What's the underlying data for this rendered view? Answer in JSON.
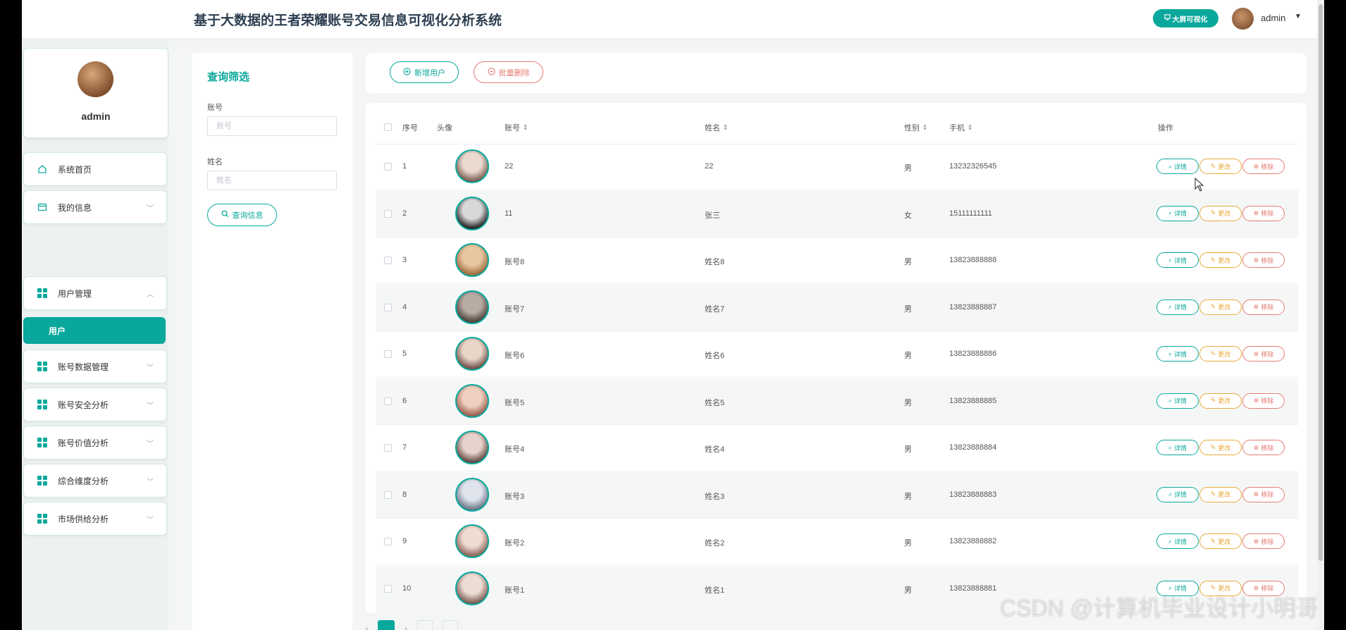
{
  "header": {
    "title": "基于大数据的王者荣耀账号交易信息可视化分析系统",
    "bigscreen_label": "大屏可视化",
    "username": "admin"
  },
  "profile": {
    "name": "admin"
  },
  "sidebar": {
    "items": [
      {
        "label": "系统首页",
        "icon": "home-icon"
      },
      {
        "label": "我的信息",
        "icon": "card-icon"
      },
      {
        "label": "用户管理",
        "icon": "grid-icon",
        "expanded": true
      },
      {
        "label": "账号数据管理",
        "icon": "grid-icon"
      },
      {
        "label": "账号安全分析",
        "icon": "grid-icon"
      },
      {
        "label": "账号价值分析",
        "icon": "grid-icon"
      },
      {
        "label": "综合维度分析",
        "icon": "grid-icon"
      },
      {
        "label": "市场供给分析",
        "icon": "grid-icon"
      }
    ],
    "active_sub": "用户"
  },
  "filter": {
    "title": "查询筛选",
    "account_label": "账号",
    "account_placeholder": "账号",
    "name_label": "姓名",
    "name_placeholder": "姓名",
    "query_button": "查询信息"
  },
  "actions": {
    "add": "新增用户",
    "batch_delete": "批量删除"
  },
  "table": {
    "columns": {
      "index": "序号",
      "avatar": "头像",
      "account": "账号",
      "name": "姓名",
      "gender": "性别",
      "phone": "手机",
      "ops": "操作"
    },
    "op_labels": {
      "detail": "详情",
      "edit": "更改",
      "remove": "移除"
    },
    "rows": [
      {
        "index": "1",
        "account": "22",
        "name": "22",
        "gender": "男",
        "phone": "13232326545"
      },
      {
        "index": "2",
        "account": "11",
        "name": "张三",
        "gender": "女",
        "phone": "15111111111"
      },
      {
        "index": "3",
        "account": "账号8",
        "name": "姓名8",
        "gender": "男",
        "phone": "13823888888"
      },
      {
        "index": "4",
        "account": "账号7",
        "name": "姓名7",
        "gender": "男",
        "phone": "13823888887"
      },
      {
        "index": "5",
        "account": "账号6",
        "name": "姓名6",
        "gender": "男",
        "phone": "13823888886"
      },
      {
        "index": "6",
        "account": "账号5",
        "name": "姓名5",
        "gender": "男",
        "phone": "13823888885"
      },
      {
        "index": "7",
        "account": "账号4",
        "name": "姓名4",
        "gender": "男",
        "phone": "13823888884"
      },
      {
        "index": "8",
        "account": "账号3",
        "name": "姓名3",
        "gender": "男",
        "phone": "13823888883"
      },
      {
        "index": "9",
        "account": "账号2",
        "name": "姓名2",
        "gender": "男",
        "phone": "13823888882"
      },
      {
        "index": "10",
        "account": "账号1",
        "name": "姓名1",
        "gender": "男",
        "phone": "13823888881"
      }
    ]
  },
  "watermark": "CSDN @计算机毕业设计小明哥 掘金技术社区"
}
